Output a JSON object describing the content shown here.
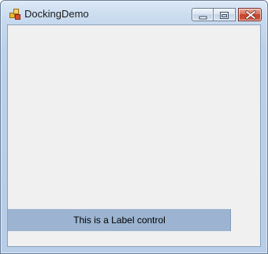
{
  "window": {
    "title": "DockingDemo",
    "icon": "windows-forms-app-icon",
    "controls": {
      "minimize_icon": "minimize-icon",
      "maximize_icon": "maximize-icon",
      "close_icon": "close-icon"
    }
  },
  "form": {
    "background_color": "#f0f0f0",
    "label": {
      "text": "This is a Label control",
      "background_color": "#9cb4d1"
    }
  }
}
